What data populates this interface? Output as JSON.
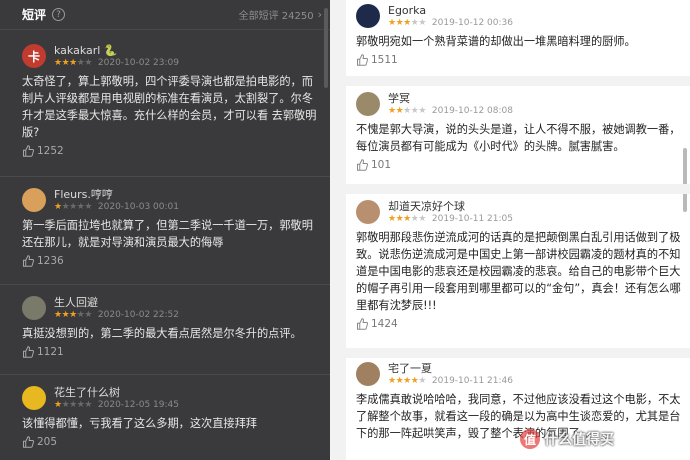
{
  "left_panel": {
    "title": "短评",
    "help_icon": "question-circle-icon",
    "all_label": "全部短评 24250",
    "chevron": "›",
    "comments": [
      {
        "avatar_text": "卡",
        "avatar_color": "#c23b2f",
        "name": "kakakarl 🐍",
        "stars": 3,
        "date": "2020-10-02 23:09",
        "text": "太奇怪了，算上郭敬明，四个评委导演也都是拍电影的，而制片人评级都是用电视剧的标准在看演员，太割裂了。尔冬升才是这季最大惊喜。充什么样的会员，才可以看 去郭敬明版?",
        "likes": "1252"
      },
      {
        "avatar_text": "",
        "avatar_color": "#d8a05a",
        "name": "Fleurs.哼哼",
        "stars": 1,
        "date": "2020-10-03 00:01",
        "text": "第一季后面拉垮也就算了，但第二季说一千道一万，郭敬明还在那儿，就是对导演和演员最大的侮辱",
        "likes": "1236"
      },
      {
        "avatar_text": "",
        "avatar_color": "#7a7a6a",
        "name": "生人回避",
        "stars": 3,
        "date": "2020-10-02 22:52",
        "text": "真挺没想到的，第二季的最大看点居然是尔冬升的点评。",
        "likes": "1121"
      },
      {
        "avatar_text": "",
        "avatar_color": "#e8b820",
        "name": "花生了什么树",
        "stars": 1,
        "date": "2020-12-05 19:45",
        "text": "该懂得都懂，亏我看了这么多期，这次直接拜拜",
        "likes": "205"
      }
    ]
  },
  "right_panel": {
    "comments": [
      {
        "avatar_color": "#1e2a4a",
        "name": "Egorka",
        "stars": 3,
        "date": "2019-10-12 00:36",
        "text": "郭敬明宛如一个熟背菜谱的却做出一堆黑暗料理的厨师。",
        "likes": "1511"
      },
      {
        "avatar_color": "#9a8a6a",
        "name": "学冥",
        "stars": 2,
        "date": "2019-10-12 08:08",
        "text": "不愧是郭大导演，说的头头是道，让人不得不服，被她调教一番，每位演员都有可能成为《小时代》的头牌。腻害腻害。",
        "likes": "101"
      },
      {
        "avatar_color": "#b89070",
        "name": "却道天凉好个球",
        "stars": 3,
        "date": "2019-10-11 21:05",
        "text": "郭敬明那段悲伤逆流成河的话真的是把颠倒黑白乱引用话做到了极致。说悲伤逆流成河是中国史上第一部讲校园霸凌的题材真的不知道是中国电影的悲哀还是校园霸凌的悲哀。给自己的电影带个巨大的帽子再引用一段套用到哪里都可以的“金句”，真会！还有怎么哪里都有沈梦辰!!!",
        "likes": "1424"
      },
      {
        "avatar_color": "#a08060",
        "name": "宅了一夏",
        "stars": 4,
        "date": "2019-10-11 21:46",
        "text": "李成儒真敢说哈哈哈，我同意，不过他应该没看过这个电影，不太了解整个故事，就看这一段的确是以为高中生谈恋爱的，尤其是台下的那一阵起哄笑声，毁了整个表演的氛围了。。",
        "likes": ""
      }
    ]
  },
  "watermark": {
    "badge": "值",
    "text": "什么值得买"
  }
}
